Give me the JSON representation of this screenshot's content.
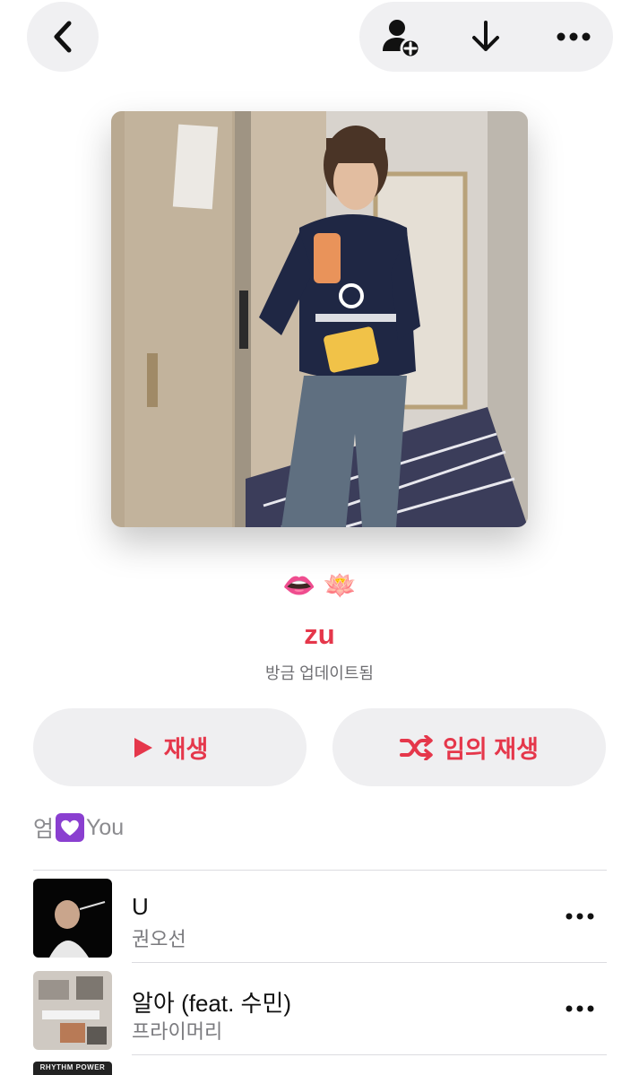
{
  "nav": {
    "back_icon": "chevron-left-icon",
    "add_person_icon": "person-add-icon",
    "download_icon": "download-arrow-icon",
    "more_icon": "ellipsis-icon"
  },
  "playlist": {
    "emoji": "👄 🪷",
    "title": "zu",
    "subtitle": "방금 업데이트됨",
    "accent_color": "#e5374b"
  },
  "actions": {
    "play_label": "재생",
    "shuffle_label": "임의 재생"
  },
  "description": {
    "prefix": "엄",
    "suffix": "You"
  },
  "tracks": [
    {
      "title": "U",
      "artist": "권오선"
    },
    {
      "title": "알아 (feat. 수민)",
      "artist": "프라이머리"
    },
    {
      "partial_art_text": "RHYTHM POWER"
    }
  ]
}
